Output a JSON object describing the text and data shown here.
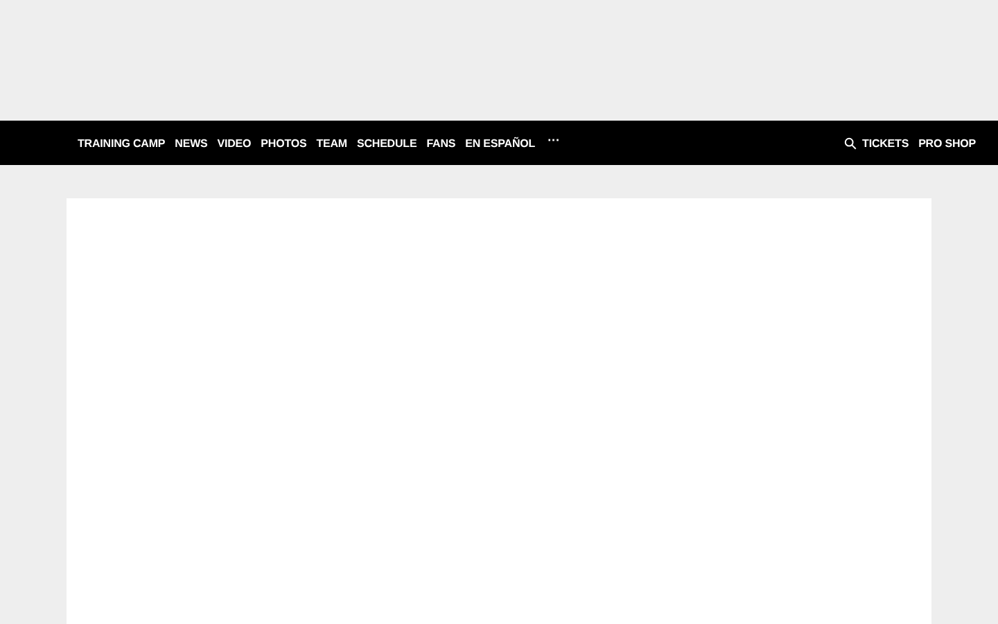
{
  "nav": {
    "links": [
      "TRAINING CAMP",
      "NEWS",
      "VIDEO",
      "PHOTOS",
      "TEAM",
      "SCHEDULE",
      "FANS",
      "EN ESPAÑOL"
    ],
    "more": "···",
    "right_links": [
      "TICKETS",
      "PRO SHOP"
    ]
  }
}
